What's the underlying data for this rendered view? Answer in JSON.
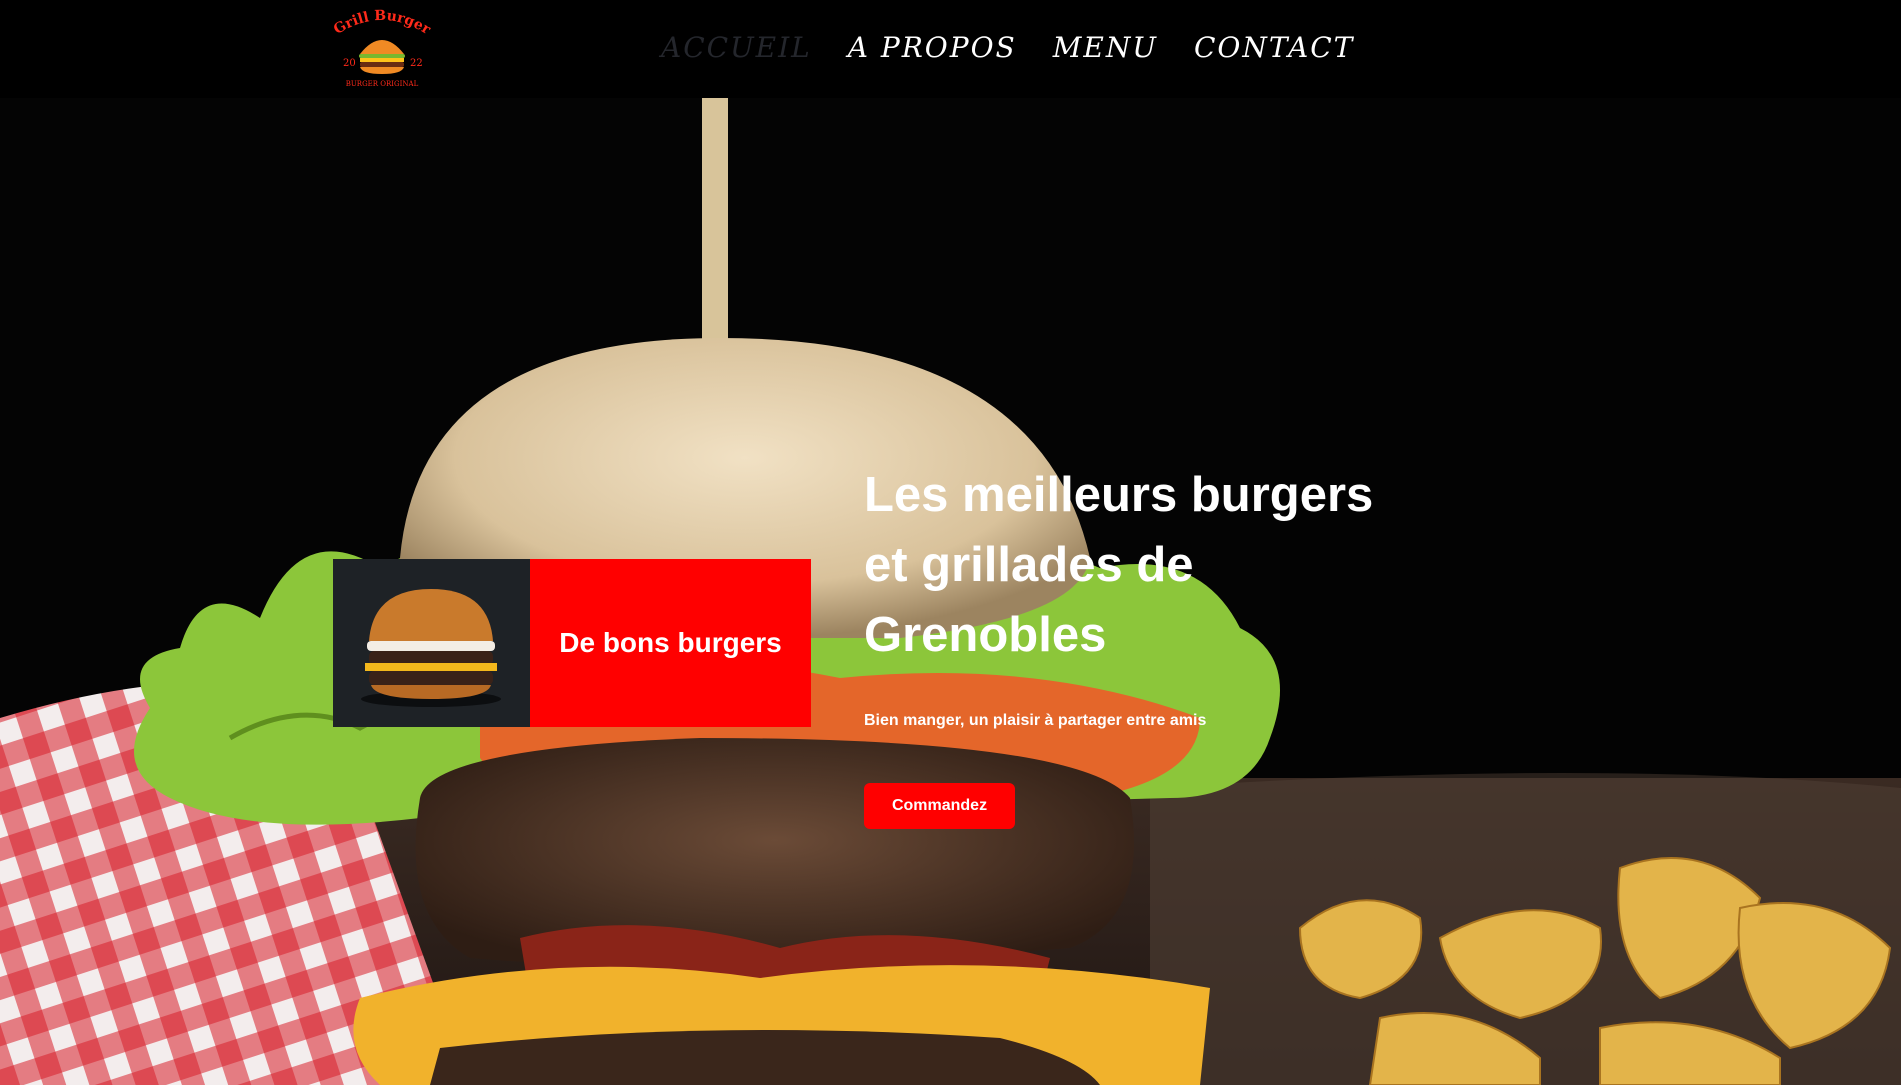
{
  "brand": {
    "logo_line1": "Grill Burger",
    "logo_year_left": "20",
    "logo_year_right": "22",
    "logo_tagline": "BURGER ORIGINAL",
    "accent": "#ff0000"
  },
  "nav": {
    "items": [
      {
        "label": "ACCUEIL",
        "active": true
      },
      {
        "label": "A PROPOS",
        "active": false
      },
      {
        "label": "MENU",
        "active": false
      },
      {
        "label": "CONTACT",
        "active": false
      }
    ]
  },
  "hero": {
    "title": "Les meilleurs burgers et grillades de Grenobles",
    "subtitle": "Bien manger, un plaisir à partager entre amis",
    "cta_label": "Commandez"
  },
  "feature_card": {
    "label": "De bons burgers",
    "image_icon": "burger-photo"
  }
}
